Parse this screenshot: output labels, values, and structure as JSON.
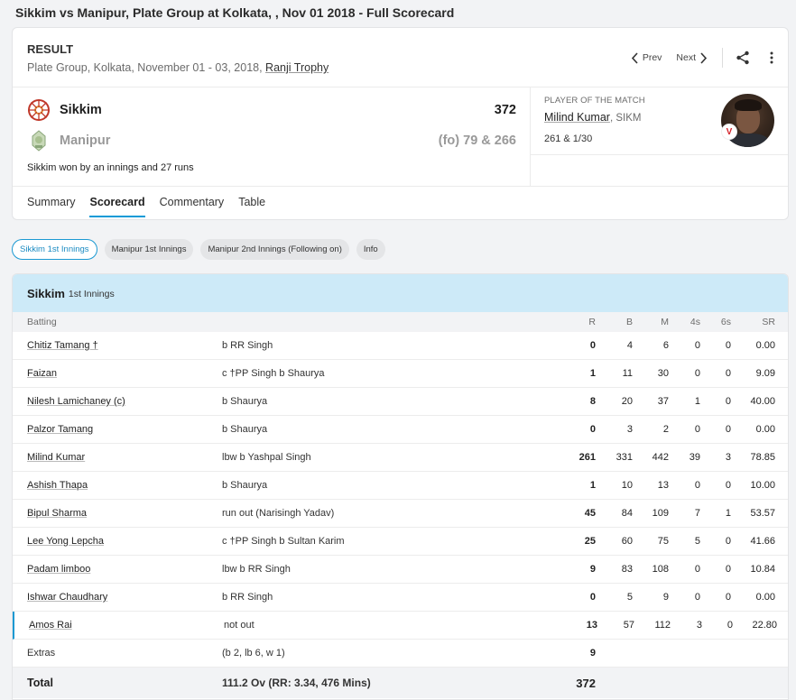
{
  "page_title": "Sikkim vs Manipur, Plate Group at Kolkata, , Nov 01 2018 - Full Scorecard",
  "header": {
    "status": "RESULT",
    "match_info": "Plate Group, Kolkata, November 01 - 03, 2018, ",
    "trophy": "Ranji Trophy",
    "prev_label": "Prev",
    "next_label": "Next"
  },
  "teams": [
    {
      "name": "Sikkim",
      "score": "372",
      "fo": ""
    },
    {
      "name": "Manipur",
      "score": "79 & 266",
      "fo": "(fo) "
    }
  ],
  "result": "Sikkim won by an innings and 27 runs",
  "potm": {
    "label": "PLAYER OF THE MATCH",
    "name": "Milind Kumar",
    "team": ", SIKM",
    "stats": "261 & 1/30",
    "badge": "V"
  },
  "tabs": [
    "Summary",
    "Scorecard",
    "Commentary",
    "Table"
  ],
  "active_tab": "Scorecard",
  "innings_pills": [
    "Sikkim 1st Innings",
    "Manipur 1st Innings",
    "Manipur 2nd Innings (Following on)",
    "Info"
  ],
  "innings": {
    "team": "Sikkim",
    "label": "1st Innings",
    "columns": {
      "batting": "Batting",
      "r": "R",
      "b": "B",
      "m": "M",
      "fours": "4s",
      "sixes": "6s",
      "sr": "SR"
    },
    "batters": [
      {
        "name": "Chitiz Tamang †",
        "dismissal": "b RR Singh",
        "r": "0",
        "b": "4",
        "m": "6",
        "fours": "0",
        "sixes": "0",
        "sr": "0.00"
      },
      {
        "name": "Faizan",
        "dismissal": "c †PP Singh b Shaurya",
        "r": "1",
        "b": "11",
        "m": "30",
        "fours": "0",
        "sixes": "0",
        "sr": "9.09"
      },
      {
        "name": "Nilesh Lamichaney (c)",
        "dismissal": "b Shaurya",
        "r": "8",
        "b": "20",
        "m": "37",
        "fours": "1",
        "sixes": "0",
        "sr": "40.00"
      },
      {
        "name": "Palzor Tamang",
        "dismissal": "b Shaurya",
        "r": "0",
        "b": "3",
        "m": "2",
        "fours": "0",
        "sixes": "0",
        "sr": "0.00"
      },
      {
        "name": "Milind Kumar",
        "dismissal": "lbw b Yashpal Singh",
        "r": "261",
        "b": "331",
        "m": "442",
        "fours": "39",
        "sixes": "3",
        "sr": "78.85"
      },
      {
        "name": "Ashish Thapa",
        "dismissal": "b Shaurya",
        "r": "1",
        "b": "10",
        "m": "13",
        "fours": "0",
        "sixes": "0",
        "sr": "10.00"
      },
      {
        "name": "Bipul Sharma",
        "dismissal": "run out (Narisingh Yadav)",
        "r": "45",
        "b": "84",
        "m": "109",
        "fours": "7",
        "sixes": "1",
        "sr": "53.57"
      },
      {
        "name": "Lee Yong Lepcha",
        "dismissal": "c †PP Singh b Sultan Karim",
        "r": "25",
        "b": "60",
        "m": "75",
        "fours": "5",
        "sixes": "0",
        "sr": "41.66"
      },
      {
        "name": "Padam limboo",
        "dismissal": "lbw b RR Singh",
        "r": "9",
        "b": "83",
        "m": "108",
        "fours": "0",
        "sixes": "0",
        "sr": "10.84"
      },
      {
        "name": "Ishwar Chaudhary",
        "dismissal": "b RR Singh",
        "r": "0",
        "b": "5",
        "m": "9",
        "fours": "0",
        "sixes": "0",
        "sr": "0.00"
      },
      {
        "name": "Amos Rai",
        "dismissal": "not out",
        "r": "13",
        "b": "57",
        "m": "112",
        "fours": "3",
        "sixes": "0",
        "sr": "22.80",
        "not_out": true
      }
    ],
    "extras": {
      "label": "Extras",
      "detail": "(b 2, lb 6, w 1)",
      "value": "9"
    },
    "total": {
      "label": "Total",
      "detail": "111.2 Ov (RR: 3.34, 476 Mins)",
      "value": "372"
    }
  },
  "colors": {
    "accent": "#1b99d2",
    "innings_header_bg": "#cdeaf8"
  },
  "icons": [
    "chevron-left-icon",
    "chevron-right-icon",
    "share-icon",
    "more-vertical-icon",
    "sikkim-logo",
    "manipur-logo"
  ]
}
